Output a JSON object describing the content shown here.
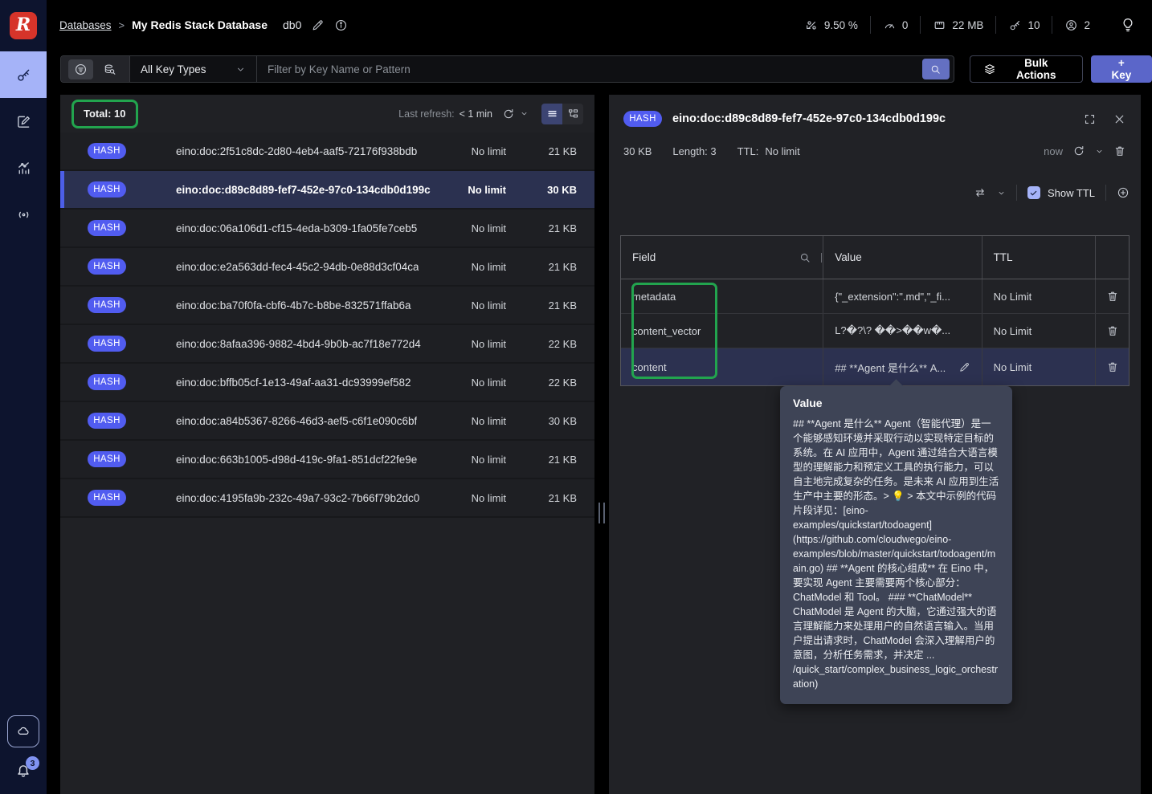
{
  "topbar": {
    "breadcrumb": "Databases",
    "breadcrumb_sep": ">",
    "title": "My Redis Stack Database",
    "db_index": "db0",
    "stats": [
      {
        "icon": "cpu-usage",
        "value": "9.50 %"
      },
      {
        "icon": "commands-per-sec",
        "value": "0"
      },
      {
        "icon": "memory",
        "value": "22 MB"
      },
      {
        "icon": "total-keys",
        "value": "10"
      },
      {
        "icon": "connected-clients",
        "value": "2"
      }
    ]
  },
  "filterbar": {
    "key_type_filter": "All Key Types",
    "search_placeholder": "Filter by Key Name or Pattern",
    "bulk_actions_label": "Bulk Actions",
    "add_key_label": "+ Key"
  },
  "keylist": {
    "total_label": "Total: 10",
    "last_refresh_label": "Last refresh:",
    "last_refresh_value": "< 1 min",
    "rows": [
      {
        "type": "HASH",
        "name": "eino:doc:2f51c8dc-2d80-4eb4-aaf5-72176f938bdb",
        "ttl": "No limit",
        "size": "21 KB"
      },
      {
        "type": "HASH",
        "name": "eino:doc:d89c8d89-fef7-452e-97c0-134cdb0d199c",
        "ttl": "No limit",
        "size": "30 KB"
      },
      {
        "type": "HASH",
        "name": "eino:doc:06a106d1-cf15-4eda-b309-1fa05fe7ceb5",
        "ttl": "No limit",
        "size": "21 KB"
      },
      {
        "type": "HASH",
        "name": "eino:doc:e2a563dd-fec4-45c2-94db-0e88d3cf04ca",
        "ttl": "No limit",
        "size": "21 KB"
      },
      {
        "type": "HASH",
        "name": "eino:doc:ba70f0fa-cbf6-4b7c-b8be-832571ffab6a",
        "ttl": "No limit",
        "size": "21 KB"
      },
      {
        "type": "HASH",
        "name": "eino:doc:8afaa396-9882-4bd4-9b0b-ac7f18e772d4",
        "ttl": "No limit",
        "size": "22 KB"
      },
      {
        "type": "HASH",
        "name": "eino:doc:bffb05cf-1e13-49af-aa31-dc93999ef582",
        "ttl": "No limit",
        "size": "22 KB"
      },
      {
        "type": "HASH",
        "name": "eino:doc:a84b5367-8266-46d3-aef5-c6f1e090c6bf",
        "ttl": "No limit",
        "size": "30 KB"
      },
      {
        "type": "HASH",
        "name": "eino:doc:663b1005-d98d-419c-9fa1-851dcf22fe9e",
        "ttl": "No limit",
        "size": "21 KB"
      },
      {
        "type": "HASH",
        "name": "eino:doc:4195fa9b-232c-49a7-93c2-7b66f79b2dc0",
        "ttl": "No limit",
        "size": "21 KB"
      }
    ]
  },
  "details": {
    "type": "HASH",
    "key_name": "eino:doc:d89c8d89-fef7-452e-97c0-134cdb0d199c",
    "size": "30 KB",
    "length_label": "Length: 3",
    "ttl_label": "TTL:",
    "ttl_value": "No limit",
    "refresh_value": "now",
    "show_ttl_label": "Show TTL",
    "table": {
      "col_field": "Field",
      "col_value": "Value",
      "col_ttl": "TTL",
      "rows": [
        {
          "field": "metadata",
          "value": "{\"_extension\":\".md\",\"_fi...",
          "ttl": "No Limit"
        },
        {
          "field": "content_vector",
          "value": "L?�?\\? ��>��w�...",
          "ttl": "No Limit"
        },
        {
          "field": "content",
          "value": "## **Agent 是什么** A...",
          "ttl": "No Limit"
        }
      ]
    }
  },
  "tooltip": {
    "title": "Value",
    "body": "## **Agent 是什么** Agent（智能代理）是一个能够感知环境并采取行动以实现特定目标的系统。在 AI 应用中，Agent 通过结合大语言模型的理解能力和预定义工具的执行能力，可以自主地完成复杂的任务。是未来 AI 应用到生活生产中主要的形态。> 💡 > 本文中示例的代码片段详见：[eino-examples/quickstart/todoagent](https://github.com/cloudwego/eino-examples/blob/master/quickstart/todoagent/main.go) ## **Agent 的核心组成** 在 Eino 中，要实现 Agent 主要需要两个核心部分：ChatModel 和 Tool。 ### **ChatModel** ChatModel 是 Agent 的大脑，它通过强大的语言理解能力来处理用户的自然语言输入。当用户提出请求时，ChatModel 会深入理解用户的意图，分析任务需求，并决定 ... /quick_start/complex_business_logic_orchestration)"
  },
  "sidebar": {
    "notifications_count": "3",
    "logo_glyph": "R"
  },
  "colors": {
    "accent": "#515cf0",
    "annotation_green": "#22a44e",
    "selected_row": "#2b3150",
    "sidebar_bg": "#0d142e",
    "panel_bg": "#212226",
    "tooltip_bg": "#3e4456"
  }
}
